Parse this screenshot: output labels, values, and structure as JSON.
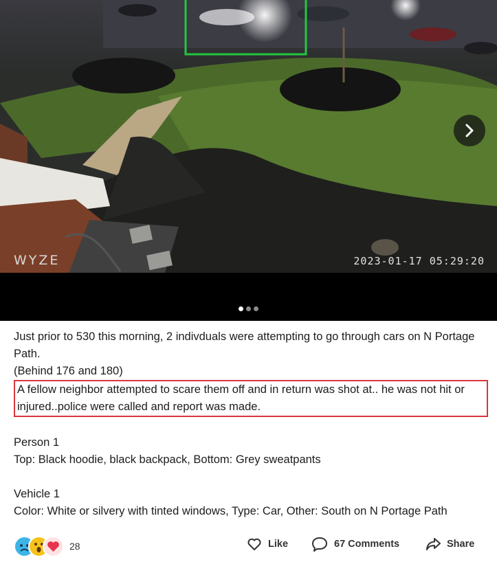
{
  "media": {
    "watermark": "WYZE",
    "timestamp": "2023-01-17 05:29:20",
    "next_icon": "chevron-right-icon",
    "slides": 3,
    "active_slide": 1
  },
  "post": {
    "line1": "Just prior to 530 this morning, 2 indivduals were attempting to go through cars on N Portage Path.",
    "line2": "(Behind 176 and 180)",
    "highlight": "A fellow neighbor attempted to scare them off and in return was shot at.. he was not hit or injured..police were called and report was made.",
    "person_heading": "Person 1",
    "person_desc": "Top: Black hoodie, black backpack, Bottom: Grey sweatpants",
    "vehicle_heading": "Vehicle 1",
    "vehicle_desc": "Color: White or silvery with tinted windows, Type: Car, Other: South on N Portage Path",
    "highlight_color": "#d9353b"
  },
  "actions": {
    "reaction_icons": [
      "sad-icon",
      "wow-icon",
      "heart-icon"
    ],
    "reaction_count": "28",
    "like_label": "Like",
    "comments_label": "67 Comments",
    "share_label": "Share"
  }
}
